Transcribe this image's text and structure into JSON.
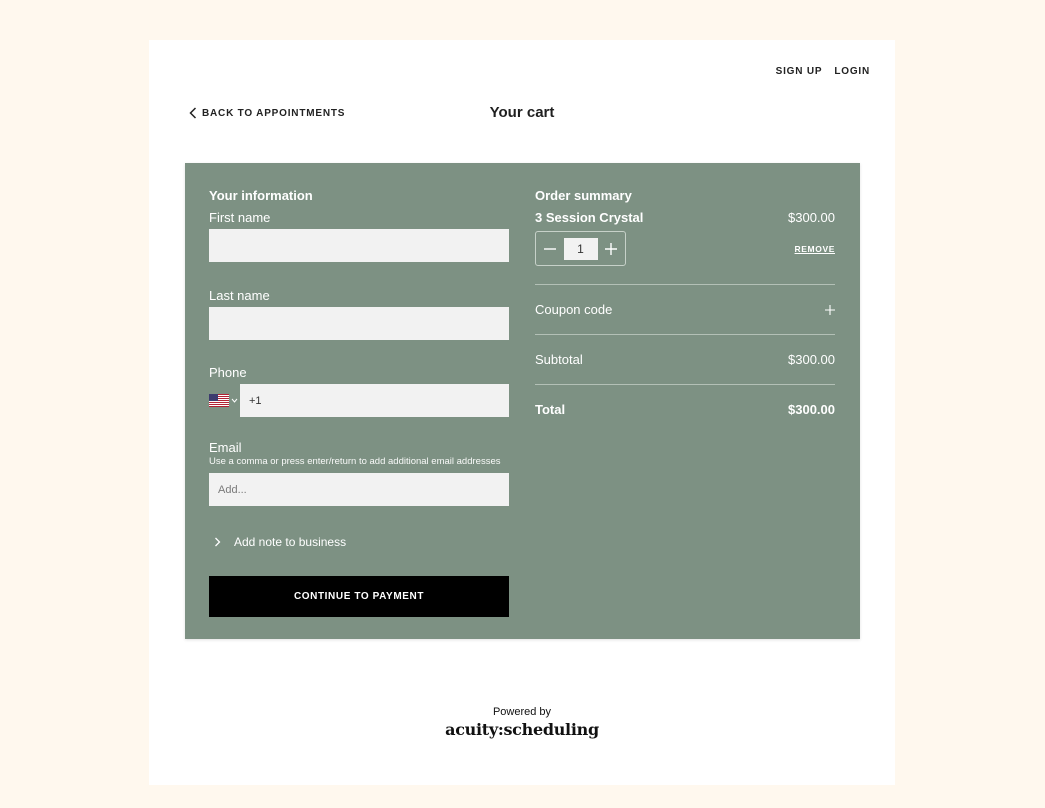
{
  "nav": {
    "signup": "SIGN UP",
    "login": "LOGIN"
  },
  "back_link": "BACK TO APPOINTMENTS",
  "page_title": "Your cart",
  "info": {
    "title": "Your information",
    "first_name_label": "First name",
    "first_name_value": "",
    "last_name_label": "Last name",
    "last_name_value": "",
    "phone_label": "Phone",
    "phone_value": "+1",
    "email_label": "Email",
    "email_helper": "Use a comma or press enter/return to add additional email addresses",
    "email_placeholder": "Add...",
    "note_toggle": "Add note to business",
    "continue_button": "CONTINUE TO PAYMENT"
  },
  "summary": {
    "title": "Order summary",
    "item_name": "3 Session Crystal",
    "item_price": "$300.00",
    "quantity": "1",
    "remove": "REMOVE",
    "coupon_label": "Coupon code",
    "subtotal_label": "Subtotal",
    "subtotal_value": "$300.00",
    "total_label": "Total",
    "total_value": "$300.00"
  },
  "footer": {
    "powered_by": "Powered by",
    "logo": "acuity:scheduling"
  },
  "colors": {
    "panel": "#7d9183",
    "page_bg": "#fff8ee",
    "button": "#000000"
  }
}
